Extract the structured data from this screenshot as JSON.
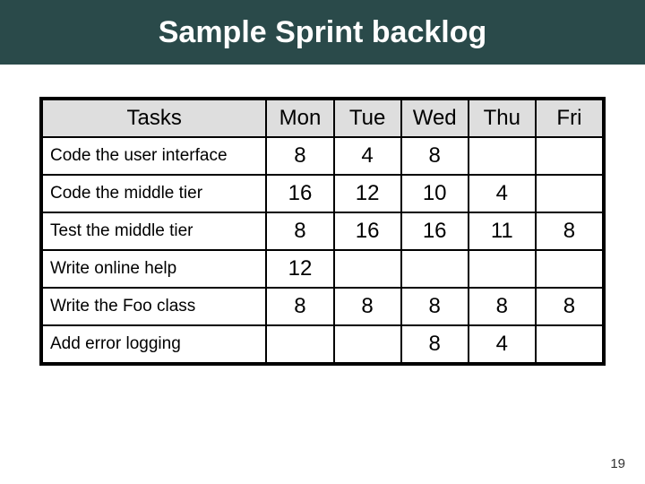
{
  "title": "Sample Sprint backlog",
  "page_number": "19",
  "chart_data": {
    "type": "table",
    "columns": [
      "Tasks",
      "Mon",
      "Tue",
      "Wed",
      "Thu",
      "Fri"
    ],
    "rows": [
      {
        "task": "Code the user interface",
        "Mon": "8",
        "Tue": "4",
        "Wed": "8",
        "Thu": "",
        "Fri": ""
      },
      {
        "task": "Code the middle tier",
        "Mon": "16",
        "Tue": "12",
        "Wed": "10",
        "Thu": "4",
        "Fri": ""
      },
      {
        "task": "Test the middle tier",
        "Mon": "8",
        "Tue": "16",
        "Wed": "16",
        "Thu": "11",
        "Fri": "8"
      },
      {
        "task": "Write online help",
        "Mon": "12",
        "Tue": "",
        "Wed": "",
        "Thu": "",
        "Fri": ""
      },
      {
        "task": "Write the Foo class",
        "Mon": "8",
        "Tue": "8",
        "Wed": "8",
        "Thu": "8",
        "Fri": "8"
      },
      {
        "task": "Add error logging",
        "Mon": "",
        "Tue": "",
        "Wed": "8",
        "Thu": "4",
        "Fri": ""
      }
    ]
  }
}
